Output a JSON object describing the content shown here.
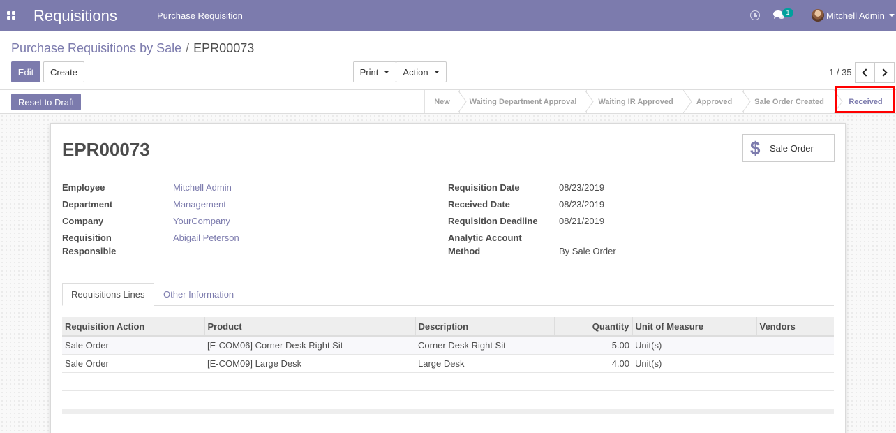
{
  "navbar": {
    "app_title": "Requisitions",
    "menu_item": "Purchase Requisition",
    "chat_badge": "1",
    "user_name": "Mitchell Admin",
    "bg_color": "#7c7bad"
  },
  "breadcrumb": {
    "parent": "Purchase Requisitions by Sale",
    "separator": "/",
    "current": "EPR00073"
  },
  "buttons": {
    "edit": "Edit",
    "create": "Create",
    "print": "Print",
    "action": "Action",
    "reset_to_draft": "Reset to Draft"
  },
  "pager": {
    "value": "1 / 35"
  },
  "statusbar": {
    "stages": [
      "New",
      "Waiting Department Approval",
      "Waiting IR Approved",
      "Approved",
      "Sale Order Created",
      "Received"
    ],
    "active_stage": "Received"
  },
  "record": {
    "title": "EPR00073",
    "smart_button": "Sale Order",
    "left_fields": [
      {
        "label": "Employee",
        "value": "Mitchell Admin"
      },
      {
        "label": "Department",
        "value": "Management"
      },
      {
        "label": "Company",
        "value": "YourCompany"
      },
      {
        "label": "Requisition Responsible",
        "label_line1": "Requisition",
        "label_line2": "Responsible",
        "value": "Abigail Peterson"
      }
    ],
    "right_fields": [
      {
        "label": "Requisition Date",
        "value": "08/23/2019"
      },
      {
        "label": "Received Date",
        "value": "08/23/2019"
      },
      {
        "label": "Requisition Deadline",
        "value": "08/21/2019"
      },
      {
        "label": "Analytic Account",
        "value": ""
      },
      {
        "label": "Method",
        "value": "By Sale Order"
      }
    ]
  },
  "tabs": [
    "Requisitions Lines",
    "Other Information"
  ],
  "lines_table": {
    "columns": [
      "Requisition Action",
      "Product",
      "Description",
      "Quantity",
      "Unit of Measure",
      "Vendors"
    ],
    "rows": [
      [
        "Sale Order",
        "[E-COM06] Corner Desk Right Sit",
        "Corner Desk Right Sit",
        "5.00",
        "Unit(s)",
        ""
      ],
      [
        "Sale Order",
        "[E-COM09] Large Desk",
        "Large Desk",
        "4.00",
        "Unit(s)",
        ""
      ]
    ]
  }
}
